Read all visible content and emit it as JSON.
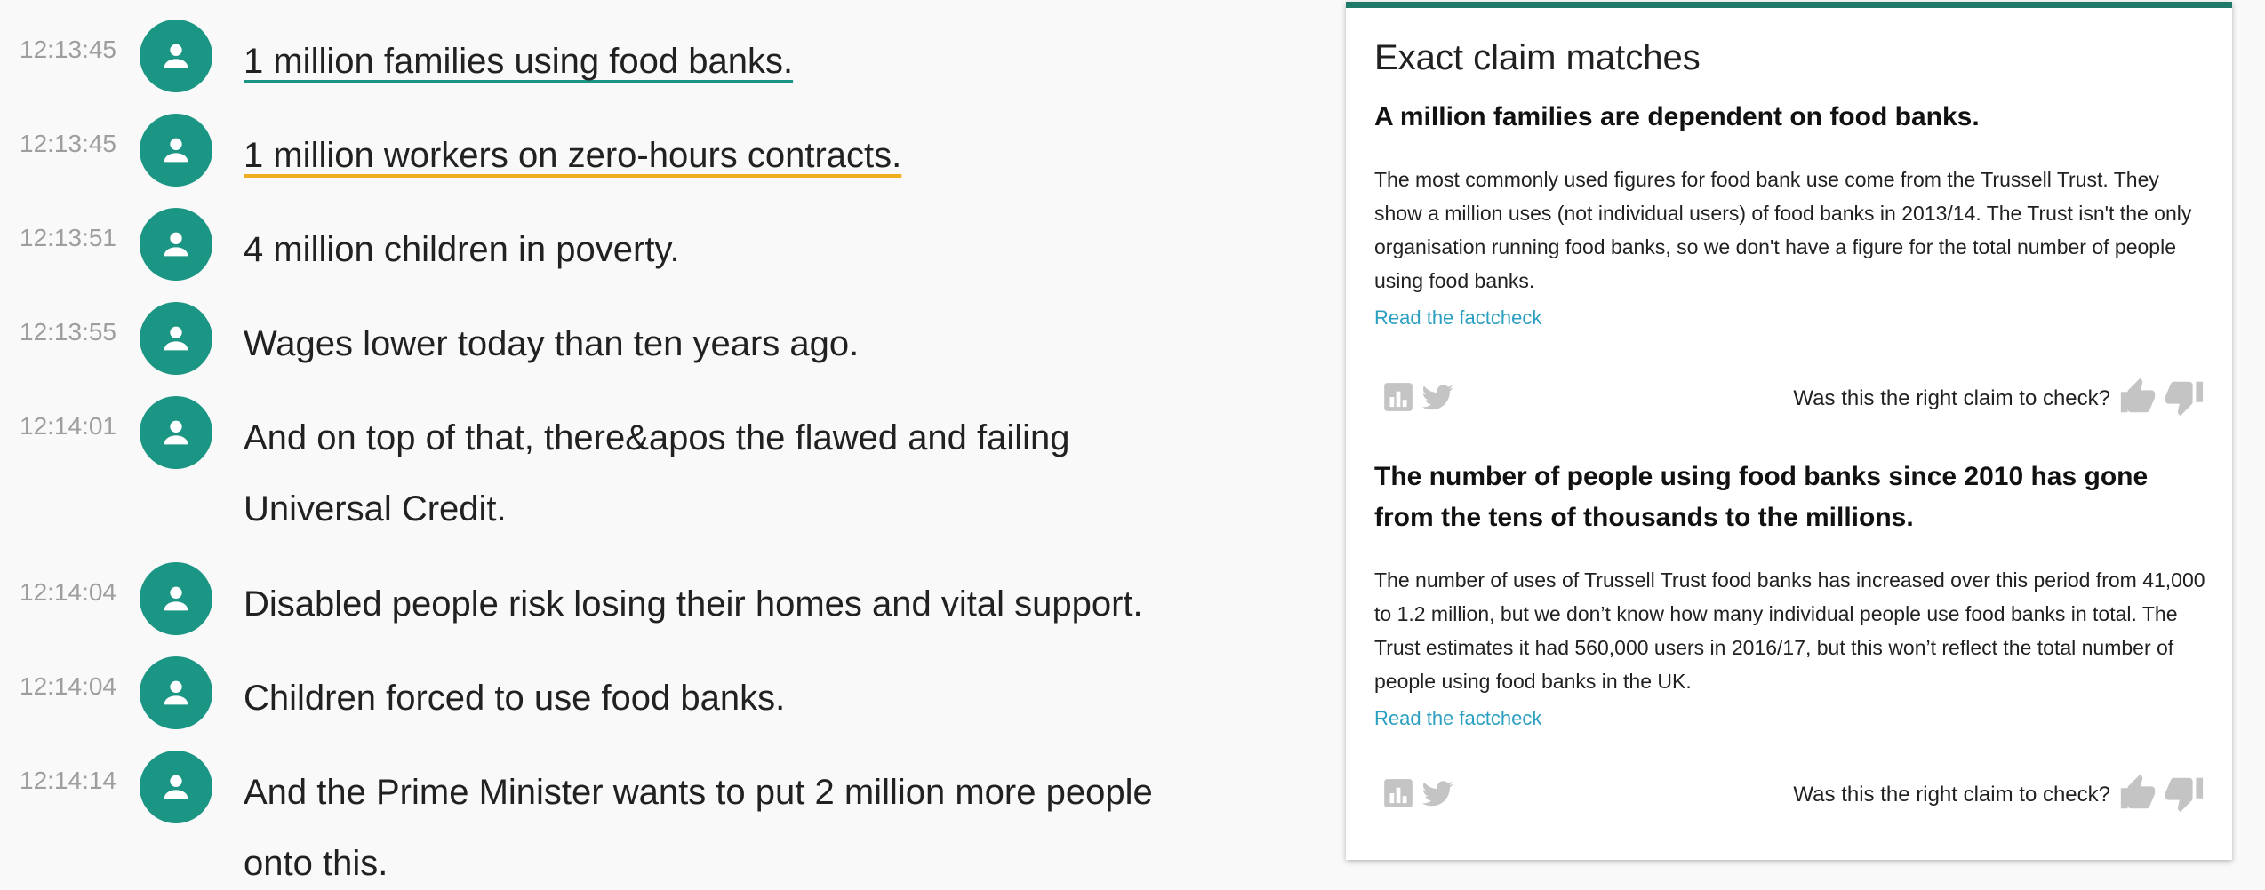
{
  "transcript": {
    "lines": [
      {
        "time": "12:13:45",
        "text": [
          "1 million families using food banks."
        ],
        "underline": "green"
      },
      {
        "time": "12:13:45",
        "text": [
          "1 million workers on zero-hours contracts."
        ],
        "underline": "orange"
      },
      {
        "time": "12:13:51",
        "text": [
          "4 million children in poverty."
        ]
      },
      {
        "time": "12:13:55",
        "text": [
          "Wages lower today than ten years ago."
        ]
      },
      {
        "time": "12:14:01",
        "text": [
          "And on top of that, there&apos the flawed and failing",
          "Universal Credit."
        ]
      },
      {
        "time": "12:14:04",
        "text": [
          "Disabled people risk losing their homes and vital support."
        ]
      },
      {
        "time": "12:14:04",
        "text": [
          "Children forced to use food banks."
        ]
      },
      {
        "time": "12:14:14",
        "text": [
          "And the Prime Minister wants to put 2 million more people",
          "onto this."
        ]
      }
    ],
    "avatar_icon": "person-icon"
  },
  "panel": {
    "title": "Exact claim matches",
    "claims": [
      {
        "title": "A million families are dependent on food banks.",
        "body": "The most commonly used figures for food bank use come from the Trussell Trust. They show a million uses (not individual users) of food banks in 2013/14. The Trust isn't the only organisation running food banks, so we don't have a figure for the total number of people using food banks.",
        "link": "Read the factcheck",
        "feedback_question": "Was this the right claim to check?"
      },
      {
        "title": "The number of people using food banks since 2010 has gone from the tens of thousands to the millions.",
        "body": "The number of uses of Trussell Trust food banks has increased over this period from 41,000 to 1.2 million, but we don’t know how many individual people use food banks in total. The Trust estimates it had 560,000 users in 2016/17, but this won’t reflect the total number of people using food banks in the UK.",
        "link": "Read the factcheck",
        "feedback_question": "Was this the right claim to check?"
      }
    ],
    "icons": [
      "bar-chart-icon",
      "twitter-icon",
      "thumbs-up-icon",
      "thumbs-down-icon"
    ]
  },
  "colors": {
    "avatar": "#1b9584",
    "underline_green": "#1b9584",
    "underline_orange": "#f0ad1e",
    "panel_accent": "#1f7a6a",
    "link": "#2a9fc0",
    "timestamp": "#9e9e9e",
    "icon_grey": "#c4c4c4"
  }
}
